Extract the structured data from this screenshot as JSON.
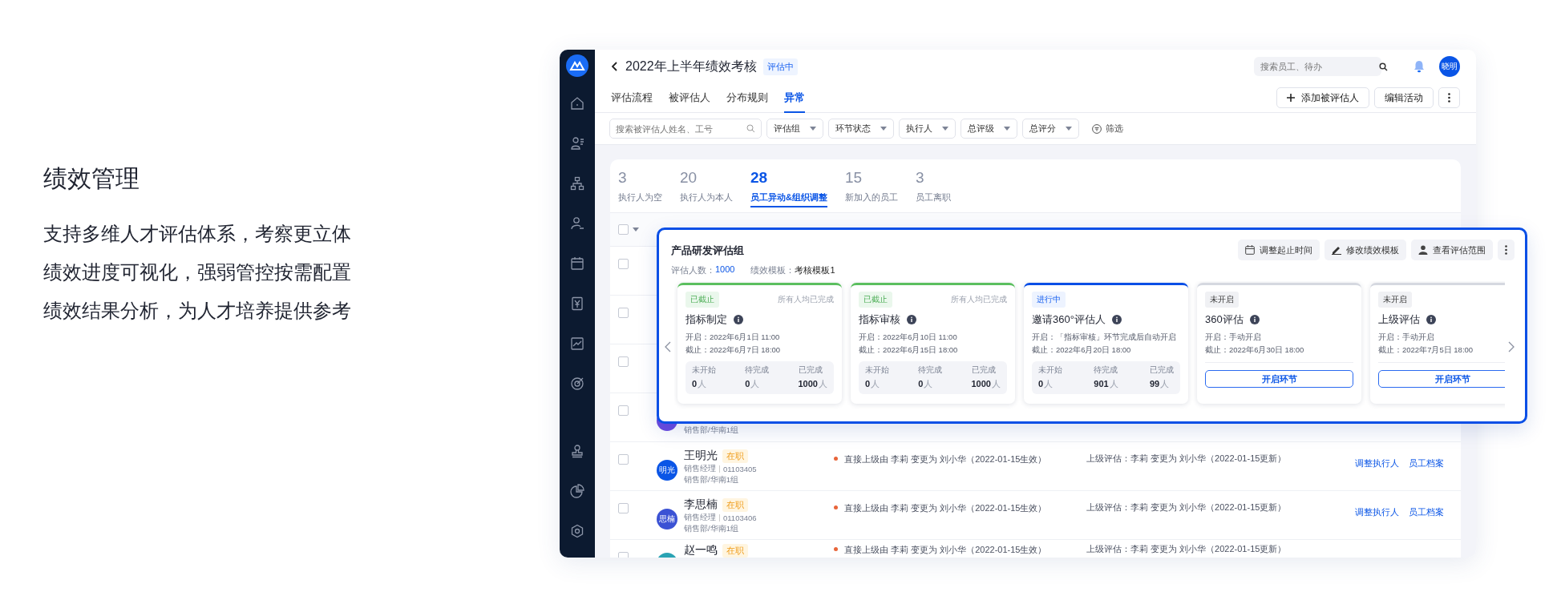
{
  "intro": {
    "title": "绩效管理",
    "lines": [
      "支持多维人才评估体系，考察更立体",
      "绩效进度可视化，强弱管控按需配置",
      "绩效结果分析，为人才培养提供参考"
    ]
  },
  "header": {
    "title": "2022年上半年绩效考核",
    "status": "评估中",
    "search_placeholder": "搜索员工、待办",
    "avatar": "晓明"
  },
  "tabs": [
    {
      "label": "评估流程",
      "selected": false
    },
    {
      "label": "被评估人",
      "selected": false
    },
    {
      "label": "分布规则",
      "selected": false
    },
    {
      "label": "异常",
      "selected": true
    }
  ],
  "actions": [
    {
      "label": "添加被评估人",
      "kind": "add"
    },
    {
      "label": "编辑活动",
      "kind": "plain"
    }
  ],
  "filters": {
    "search_placeholder": "搜索被评估人姓名、工号",
    "dropdowns": [
      "评估组",
      "环节状态",
      "执行人",
      "总评级",
      "总评分"
    ],
    "filter_button": "筛选"
  },
  "stats": [
    {
      "count": "3",
      "label": "执行人为空",
      "selected": false
    },
    {
      "count": "20",
      "label": "执行人为本人",
      "selected": false
    },
    {
      "count": "28",
      "label": "员工异动&组织调整",
      "selected": true
    },
    {
      "count": "15",
      "label": "新加入的员工",
      "selected": false
    },
    {
      "count": "3",
      "label": "员工离职",
      "selected": false
    }
  ],
  "header_checkbox": {
    "checked": false
  },
  "rows": [
    {
      "checked": false
    },
    {
      "checked": false
    },
    {
      "checked": false
    },
    {
      "checked": false,
      "dept": "销售部/华南1组",
      "avatar": {
        "color": "#6a4be0"
      }
    },
    {
      "checked": false,
      "name": "王明光",
      "status": "在职",
      "avatar": {
        "text": "明光",
        "color": "#0a55e6"
      },
      "role": "销售经理",
      "id": "01103405",
      "dept": "销售部/华南1组",
      "change": "直接上级由 李莉 变更为 刘小华（2022-01-15生效）",
      "record": "上级评估：李莉 变更为 刘小华（2022-01-15更新）",
      "actions": [
        "调整执行人",
        "员工档案"
      ]
    },
    {
      "checked": false,
      "name": "李思楠",
      "status": "在职",
      "avatar": {
        "text": "思楠",
        "color": "#3b52d4"
      },
      "role": "销售经理",
      "id": "01103406",
      "dept": "销售部/华南1组",
      "change": "直接上级由 李莉 变更为 刘小华（2022-01-15生效）",
      "record": "上级评估：李莉 变更为 刘小华（2022-01-15更新）",
      "actions": [
        "调整执行人",
        "员工档案"
      ]
    },
    {
      "checked": false,
      "name": "赵一鸣",
      "status": "在职",
      "avatar": {
        "color": "#2aa3b4"
      },
      "change": "直接上级由 李莉 变更为 刘小华（2022-01-15生效）",
      "record": "上级评估：李莉 变更为 刘小华（2022-01-15更新）"
    }
  ],
  "popup": {
    "title": "产品研发评估组",
    "count_label": "评估人数：",
    "count": "1000",
    "template_label": "绩效模板：",
    "template": "考核模板1",
    "buttons": [
      {
        "label": "调整起止时间",
        "kind": "calendar"
      },
      {
        "label": "修改绩效模板",
        "kind": "edit"
      },
      {
        "label": "查看评估范围",
        "kind": "person"
      }
    ],
    "stages": [
      {
        "kind": "ended",
        "status": "已截止",
        "note": "所有人均已完成",
        "name": "指标制定",
        "open": "开启：2022年6月1日 11:00",
        "close": "截止：2022年6月7日 18:00",
        "stats": [
          {
            "label": "未开始",
            "value": "0",
            "unit": "人"
          },
          {
            "label": "待完成",
            "value": "0",
            "unit": "人"
          },
          {
            "label": "已完成",
            "value": "1000",
            "unit": "人"
          }
        ]
      },
      {
        "kind": "ended",
        "status": "已截止",
        "note": "所有人均已完成",
        "name": "指标审核",
        "open": "开启：2022年6月10日 11:00",
        "close": "截止：2022年6月15日 18:00",
        "stats": [
          {
            "label": "未开始",
            "value": "0",
            "unit": "人"
          },
          {
            "label": "待完成",
            "value": "0",
            "unit": "人"
          },
          {
            "label": "已完成",
            "value": "1000",
            "unit": "人"
          }
        ]
      },
      {
        "kind": "active",
        "status": "进行中",
        "name": "邀请360°评估人",
        "open": "开启：「指标审核」环节完成后自动开启",
        "close": "截止：2022年6月20日 18:00",
        "stats": [
          {
            "label": "未开始",
            "value": "0",
            "unit": "人"
          },
          {
            "label": "待完成",
            "value": "901",
            "unit": "人"
          },
          {
            "label": "已完成",
            "value": "99",
            "unit": "人"
          }
        ]
      },
      {
        "kind": "pending",
        "status": "未开启",
        "name": "360评估",
        "open": "开启：手动开启",
        "close": "截止：2022年6月30日 18:00",
        "button": "开启环节"
      },
      {
        "kind": "pending",
        "status": "未开启",
        "name": "上级评估",
        "open": "开启：手动开启",
        "close": "截止：2022年7月5日 18:00",
        "button": "开启环节"
      }
    ]
  }
}
